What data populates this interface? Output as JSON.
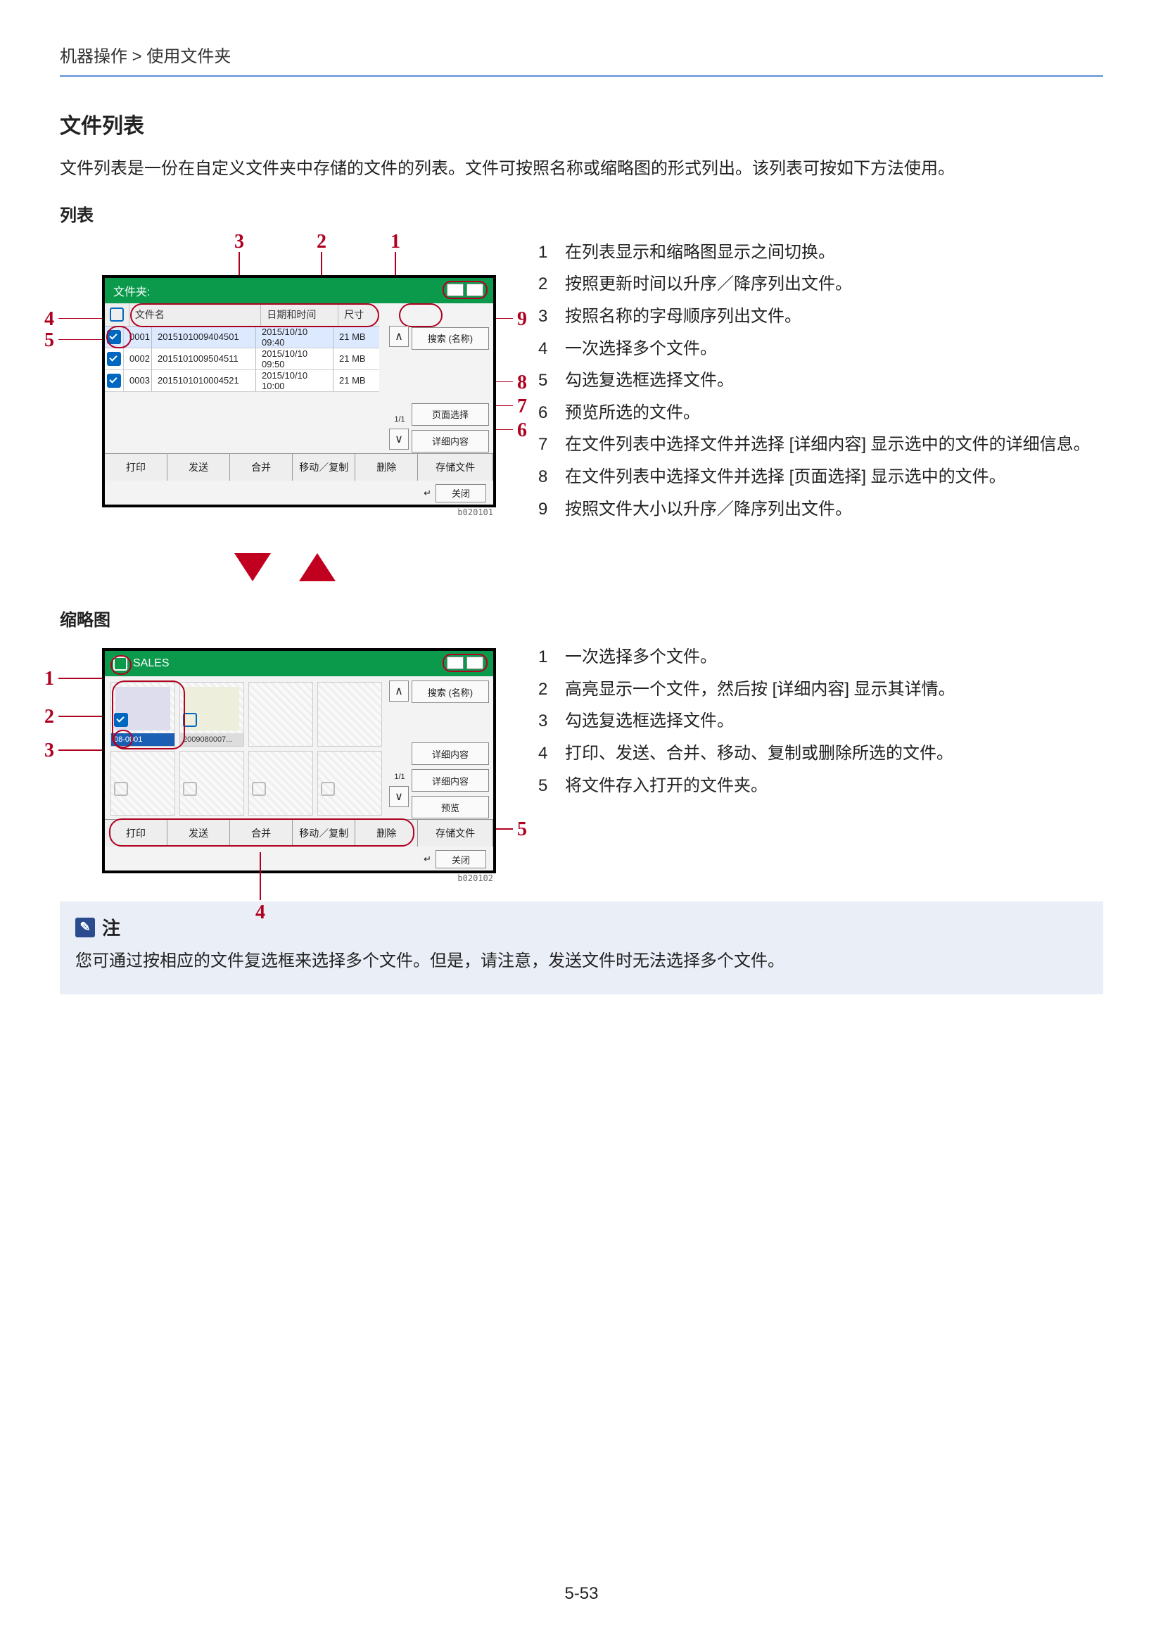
{
  "breadcrumb": "机器操作 > 使用文件夹",
  "heading": "文件列表",
  "intro": "文件列表是一份在自定义文件夹中存储的文件的列表。文件可按照名称或缩略图的形式列出。该列表可按如下方法使用。",
  "section_list": "列表",
  "section_thumb": "缩略图",
  "list_legend": {
    "1": "在列表显示和缩略图显示之间切换。",
    "2": "按照更新时间以升序／降序列出文件。",
    "3": "按照名称的字母顺序列出文件。",
    "4": "一次选择多个文件。",
    "5": "勾选复选框选择文件。",
    "6": "预览所选的文件。",
    "7": "在文件列表中选择文件并选择 [详细内容] 显示选中的文件的详细信息。",
    "8": "在文件列表中选择文件并选择 [页面选择] 显示选中的文件。",
    "9": "按照文件大小以升序／降序列出文件。"
  },
  "thumb_legend": {
    "1": "一次选择多个文件。",
    "2": "高亮显示一个文件，然后按 [详细内容] 显示其详情。",
    "3": "勾选复选框选择文件。",
    "4": "打印、发送、合并、移动、复制或删除所选的文件。",
    "5": "将文件存入打开的文件夹。"
  },
  "panel": {
    "title": "文件夹:",
    "title_thumb": "SALES",
    "col_name": "文件名",
    "col_date": "日期和时间",
    "col_size": "尺寸",
    "rows": [
      {
        "no": "0001",
        "name": "2015101009404501",
        "date": "2015/10/10 09:40",
        "size": "21 MB",
        "checked": true,
        "selected": true
      },
      {
        "no": "0002",
        "name": "2015101009504511",
        "date": "2015/10/10 09:50",
        "size": "21 MB",
        "checked": true,
        "selected": false
      },
      {
        "no": "0003",
        "name": "2015101010004521",
        "date": "2015/10/10 10:00",
        "size": "21 MB",
        "checked": true,
        "selected": false
      }
    ],
    "search": "搜索 (名称)",
    "pagepos": "1/1",
    "side_page": "页面选择",
    "side_detail": "详细内容",
    "side_preview": "预览",
    "b_print": "打印",
    "b_send": "发送",
    "b_merge": "合并",
    "b_move": "移动／复制",
    "b_delete": "删除",
    "b_store": "存储文件",
    "close": "关闭",
    "thumb_name": "2009080007..."
  },
  "note_label": "注",
  "note_text": "您可通过按相应的文件复选框来选择多个文件。但是，请注意，发送文件时无法选择多个文件。",
  "page_number": "5-53",
  "img_id_1": "b020101",
  "img_id_2": "b020102"
}
